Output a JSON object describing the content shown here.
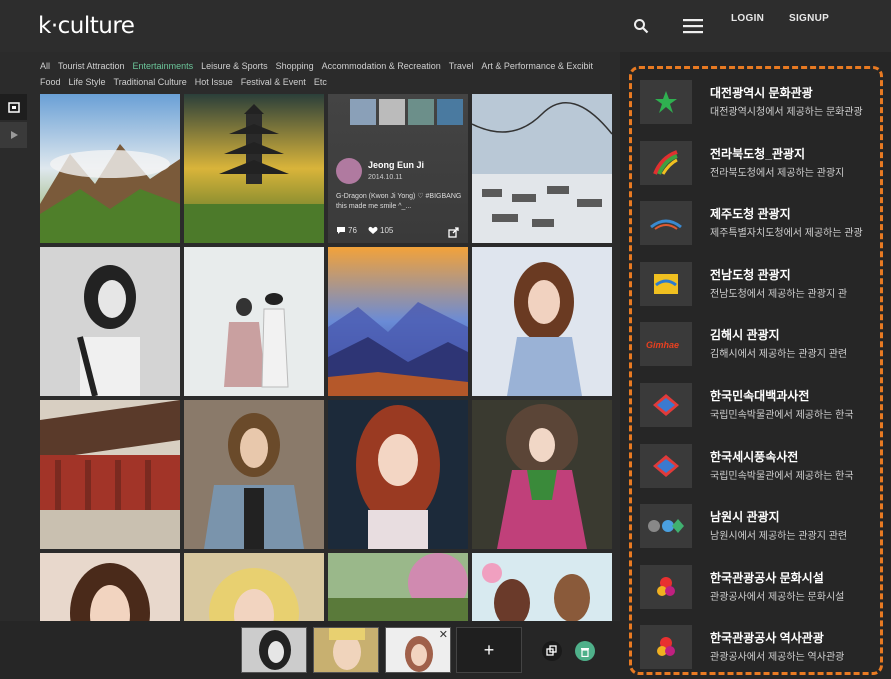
{
  "header": {
    "logo": "k·culture",
    "login": "LOGIN",
    "signup": "SIGNUP"
  },
  "categories": [
    "All",
    "Tourist Attraction",
    "Entertainments",
    "Leisure & Sports",
    "Shopping",
    "Accommodation & Recreation",
    "Travel",
    "Art & Performance & Excibit",
    "Food",
    "Life Style",
    "Traditional Culture",
    "Hot Issue",
    "Festival & Event",
    "Etc"
  ],
  "active_category": "Entertainments",
  "post": {
    "user": "Jeong Eun Ji",
    "date": "2014.10.11",
    "text": "G-Dragon (Kwon Ji Yong) ♡ #BIGBANG this made me smile ^_...",
    "comments": "76",
    "likes": "105"
  },
  "bottom": {
    "add": "+"
  },
  "right_list": [
    {
      "title": "대전광역시 문화관광",
      "desc": "대전광역시청에서 제공하는 문화관광"
    },
    {
      "title": "전라북도청_관광지",
      "desc": "전라북도청에서 제공하는 관광지"
    },
    {
      "title": "제주도청 관광지",
      "desc": "제주특별자치도청에서 제공하는 관광"
    },
    {
      "title": "전남도청 관광지",
      "desc": "전남도청에서 제공하는 관광지 관"
    },
    {
      "title": "김해시 관광지",
      "desc": "김해시에서 제공하는 관광지 관련"
    },
    {
      "title": "한국민속대백과사전",
      "desc": "국립민속박물관에서 제공하는 한국"
    },
    {
      "title": "한국세시풍속사전",
      "desc": "국립민속박물관에서 제공하는 한국"
    },
    {
      "title": "남원시 관광지",
      "desc": "남원시에서 제공하는 관광지 관련"
    },
    {
      "title": "한국관광공사 문화시설",
      "desc": "관광공사에서 제공하는 문화시설"
    },
    {
      "title": "한국관광공사 역사관광",
      "desc": "관광공사에서 제공하는 역사관광"
    }
  ]
}
